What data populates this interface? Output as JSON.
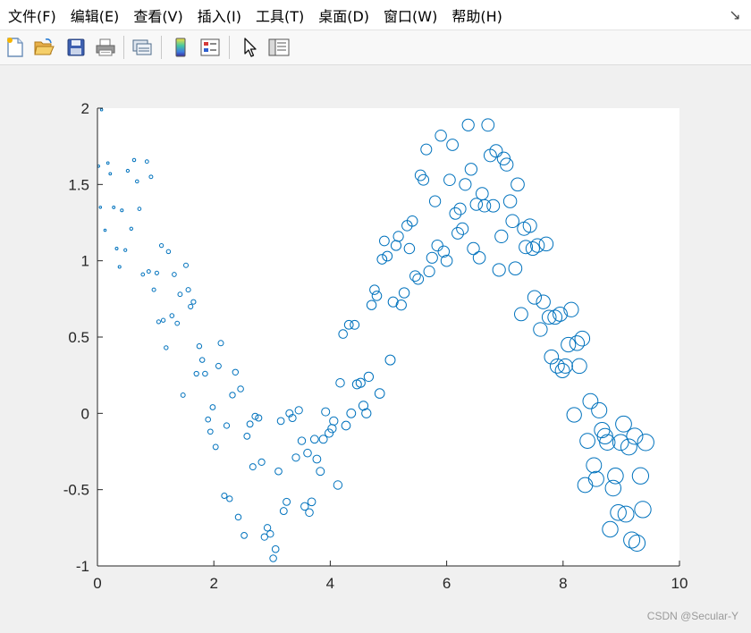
{
  "menu": {
    "items": [
      "文件(F)",
      "编辑(E)",
      "查看(V)",
      "插入(I)",
      "工具(T)",
      "桌面(D)",
      "窗口(W)",
      "帮助(H)"
    ],
    "close_glyph": "↘"
  },
  "toolbar": {
    "icons": [
      "new-figure-icon",
      "open-file-icon",
      "save-icon",
      "print-icon",
      "link-plot-icon",
      "insert-colorbar-icon",
      "insert-legend-icon",
      "pointer-icon",
      "property-inspector-icon"
    ]
  },
  "colors": {
    "marker": "#0072bd",
    "axes_bg": "#ffffff",
    "figure_bg": "#f0f0f0"
  },
  "watermark": "CSDN @Secular-Y",
  "chart_data": {
    "type": "scatter",
    "xlim": [
      0,
      10
    ],
    "ylim": [
      -1,
      2
    ],
    "xticks": [
      0,
      2,
      4,
      6,
      8,
      10
    ],
    "yticks": [
      2,
      1.5,
      1,
      0.5,
      0,
      -0.5,
      -1
    ],
    "xtick_labels": [
      "0",
      "2",
      "4",
      "6",
      "8",
      "10"
    ],
    "ytick_labels": [
      "2",
      "1.5",
      "1",
      "0.5",
      "0",
      "-0.5",
      "-1"
    ],
    "grid": false,
    "marker": "circle-open",
    "marker_size": "grows linearly with x",
    "points": [
      [
        0.02,
        1.62
      ],
      [
        0.05,
        1.35
      ],
      [
        0.07,
        1.99
      ],
      [
        0.13,
        1.2
      ],
      [
        0.18,
        1.64
      ],
      [
        0.22,
        1.57
      ],
      [
        0.28,
        1.35
      ],
      [
        0.33,
        1.08
      ],
      [
        0.38,
        0.96
      ],
      [
        0.42,
        1.33
      ],
      [
        0.48,
        1.07
      ],
      [
        0.52,
        1.59
      ],
      [
        0.58,
        1.21
      ],
      [
        0.63,
        1.66
      ],
      [
        0.68,
        1.52
      ],
      [
        0.72,
        1.34
      ],
      [
        0.78,
        0.91
      ],
      [
        0.85,
        1.65
      ],
      [
        0.88,
        0.93
      ],
      [
        0.92,
        1.55
      ],
      [
        0.97,
        0.81
      ],
      [
        1.02,
        0.92
      ],
      [
        1.05,
        0.6
      ],
      [
        1.1,
        1.1
      ],
      [
        1.13,
        0.61
      ],
      [
        1.18,
        0.43
      ],
      [
        1.22,
        1.06
      ],
      [
        1.28,
        0.64
      ],
      [
        1.32,
        0.91
      ],
      [
        1.37,
        0.59
      ],
      [
        1.42,
        0.78
      ],
      [
        1.47,
        0.12
      ],
      [
        1.52,
        0.97
      ],
      [
        1.56,
        0.81
      ],
      [
        1.6,
        0.7
      ],
      [
        1.65,
        0.73
      ],
      [
        1.7,
        0.26
      ],
      [
        1.75,
        0.44
      ],
      [
        1.8,
        0.35
      ],
      [
        1.85,
        0.26
      ],
      [
        1.9,
        -0.04
      ],
      [
        1.94,
        -0.12
      ],
      [
        1.98,
        0.04
      ],
      [
        2.03,
        -0.22
      ],
      [
        2.08,
        0.31
      ],
      [
        2.12,
        0.46
      ],
      [
        2.18,
        -0.54
      ],
      [
        2.22,
        -0.08
      ],
      [
        2.27,
        -0.56
      ],
      [
        2.32,
        0.12
      ],
      [
        2.37,
        0.27
      ],
      [
        2.42,
        -0.68
      ],
      [
        2.46,
        0.16
      ],
      [
        2.52,
        -0.8
      ],
      [
        2.57,
        -0.15
      ],
      [
        2.62,
        -0.07
      ],
      [
        2.67,
        -0.35
      ],
      [
        2.71,
        -0.02
      ],
      [
        2.77,
        -0.03
      ],
      [
        2.82,
        -0.32
      ],
      [
        2.87,
        -0.81
      ],
      [
        2.92,
        -0.75
      ],
      [
        2.97,
        -0.79
      ],
      [
        3.02,
        -0.95
      ],
      [
        3.06,
        -0.89
      ],
      [
        3.11,
        -0.38
      ],
      [
        3.15,
        -0.05
      ],
      [
        3.2,
        -0.64
      ],
      [
        3.25,
        -0.58
      ],
      [
        3.3,
        0.0
      ],
      [
        3.35,
        -0.03
      ],
      [
        3.41,
        -0.29
      ],
      [
        3.46,
        0.02
      ],
      [
        3.51,
        -0.18
      ],
      [
        3.56,
        -0.61
      ],
      [
        3.61,
        -0.26
      ],
      [
        3.64,
        -0.65
      ],
      [
        3.68,
        -0.58
      ],
      [
        3.73,
        -0.17
      ],
      [
        3.77,
        -0.3
      ],
      [
        3.83,
        -0.38
      ],
      [
        3.88,
        -0.17
      ],
      [
        3.92,
        0.01
      ],
      [
        3.98,
        -0.13
      ],
      [
        4.03,
        -0.1
      ],
      [
        4.06,
        -0.05
      ],
      [
        4.13,
        -0.47
      ],
      [
        4.17,
        0.2
      ],
      [
        4.22,
        0.52
      ],
      [
        4.27,
        -0.08
      ],
      [
        4.32,
        0.58
      ],
      [
        4.36,
        0.0
      ],
      [
        4.42,
        0.58
      ],
      [
        4.46,
        0.19
      ],
      [
        4.52,
        0.2
      ],
      [
        4.57,
        0.05
      ],
      [
        4.62,
        0.0
      ],
      [
        4.66,
        0.24
      ],
      [
        4.71,
        0.71
      ],
      [
        4.76,
        0.81
      ],
      [
        4.8,
        0.77
      ],
      [
        4.85,
        0.13
      ],
      [
        4.89,
        1.01
      ],
      [
        4.93,
        1.13
      ],
      [
        4.98,
        1.03
      ],
      [
        5.03,
        0.35
      ],
      [
        5.08,
        0.73
      ],
      [
        5.13,
        1.1
      ],
      [
        5.17,
        1.16
      ],
      [
        5.22,
        0.71
      ],
      [
        5.27,
        0.79
      ],
      [
        5.32,
        1.23
      ],
      [
        5.36,
        1.08
      ],
      [
        5.41,
        1.26
      ],
      [
        5.46,
        0.9
      ],
      [
        5.51,
        0.88
      ],
      [
        5.55,
        1.56
      ],
      [
        5.6,
        1.53
      ],
      [
        5.65,
        1.73
      ],
      [
        5.7,
        0.93
      ],
      [
        5.75,
        1.02
      ],
      [
        5.8,
        1.39
      ],
      [
        5.84,
        1.1
      ],
      [
        5.9,
        1.82
      ],
      [
        5.95,
        1.06
      ],
      [
        6.0,
        1.0
      ],
      [
        6.05,
        1.53
      ],
      [
        6.1,
        1.76
      ],
      [
        6.15,
        1.31
      ],
      [
        6.19,
        1.18
      ],
      [
        6.23,
        1.34
      ],
      [
        6.27,
        1.21
      ],
      [
        6.32,
        1.5
      ],
      [
        6.37,
        1.89
      ],
      [
        6.42,
        1.6
      ],
      [
        6.46,
        1.08
      ],
      [
        6.51,
        1.37
      ],
      [
        6.56,
        1.02
      ],
      [
        6.61,
        1.44
      ],
      [
        6.65,
        1.36
      ],
      [
        6.71,
        1.89
      ],
      [
        6.75,
        1.69
      ],
      [
        6.8,
        1.36
      ],
      [
        6.85,
        1.72
      ],
      [
        6.9,
        0.94
      ],
      [
        6.94,
        1.16
      ],
      [
        6.98,
        1.67
      ],
      [
        7.03,
        1.63
      ],
      [
        7.09,
        1.39
      ],
      [
        7.13,
        1.26
      ],
      [
        7.18,
        0.95
      ],
      [
        7.22,
        1.5
      ],
      [
        7.28,
        0.65
      ],
      [
        7.33,
        1.21
      ],
      [
        7.36,
        1.09
      ],
      [
        7.43,
        1.23
      ],
      [
        7.48,
        1.08
      ],
      [
        7.51,
        0.76
      ],
      [
        7.56,
        1.1
      ],
      [
        7.61,
        0.55
      ],
      [
        7.66,
        0.73
      ],
      [
        7.71,
        1.11
      ],
      [
        7.76,
        0.63
      ],
      [
        7.8,
        0.37
      ],
      [
        7.86,
        0.63
      ],
      [
        7.9,
        0.31
      ],
      [
        7.95,
        0.65
      ],
      [
        7.99,
        0.28
      ],
      [
        8.04,
        0.31
      ],
      [
        8.09,
        0.45
      ],
      [
        8.14,
        0.68
      ],
      [
        8.19,
        -0.01
      ],
      [
        8.24,
        0.46
      ],
      [
        8.28,
        0.31
      ],
      [
        8.33,
        0.49
      ],
      [
        8.38,
        -0.47
      ],
      [
        8.42,
        -0.18
      ],
      [
        8.47,
        0.08
      ],
      [
        8.53,
        -0.34
      ],
      [
        8.57,
        -0.43
      ],
      [
        8.62,
        0.02
      ],
      [
        8.67,
        -0.11
      ],
      [
        8.72,
        -0.15
      ],
      [
        8.76,
        -0.19
      ],
      [
        8.81,
        -0.76
      ],
      [
        8.86,
        -0.49
      ],
      [
        8.9,
        -0.41
      ],
      [
        8.95,
        -0.65
      ],
      [
        8.99,
        -0.19
      ],
      [
        9.04,
        -0.07
      ],
      [
        9.08,
        -0.66
      ],
      [
        9.13,
        -0.22
      ],
      [
        9.18,
        -0.83
      ],
      [
        9.23,
        -0.15
      ],
      [
        9.27,
        -0.85
      ],
      [
        9.33,
        -0.41
      ],
      [
        9.37,
        -0.63
      ],
      [
        9.42,
        -0.19
      ]
    ]
  }
}
